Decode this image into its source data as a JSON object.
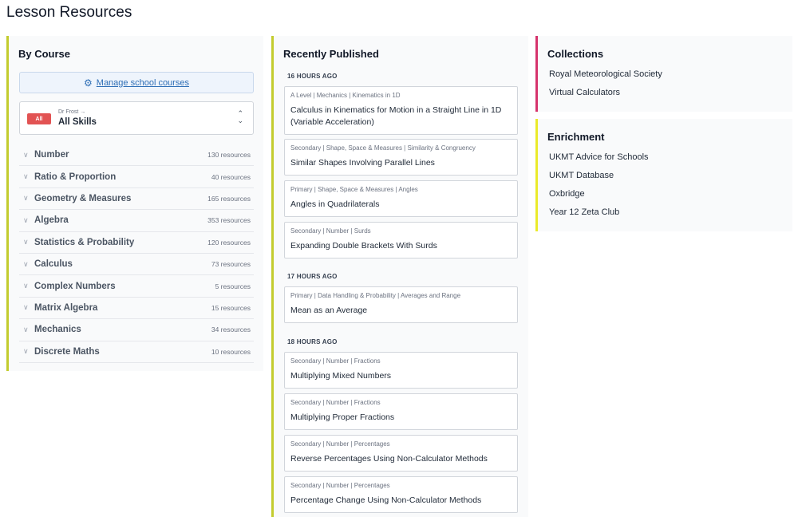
{
  "page": {
    "title": "Lesson Resources"
  },
  "by_course": {
    "title": "By Course",
    "manage_label": "Manage school courses",
    "skill_select": {
      "badge": "All",
      "author": "Dr Frost →",
      "value": "All Skills"
    },
    "courses": [
      {
        "name": "Number",
        "count": "130 resources"
      },
      {
        "name": "Ratio & Proportion",
        "count": "40 resources"
      },
      {
        "name": "Geometry & Measures",
        "count": "165 resources"
      },
      {
        "name": "Algebra",
        "count": "353 resources"
      },
      {
        "name": "Statistics & Probability",
        "count": "120 resources"
      },
      {
        "name": "Calculus",
        "count": "73 resources"
      },
      {
        "name": "Complex Numbers",
        "count": "5 resources"
      },
      {
        "name": "Matrix Algebra",
        "count": "15 resources"
      },
      {
        "name": "Mechanics",
        "count": "34 resources"
      },
      {
        "name": "Discrete Maths",
        "count": "10 resources"
      }
    ]
  },
  "recent": {
    "title": "Recently Published",
    "groups": [
      {
        "time": "16 HOURS AGO",
        "items": [
          {
            "crumb": "A Level | Mechanics | Kinematics in 1D",
            "title": "Calculus in Kinematics for Motion in a Straight Line in 1D (Variable Acceleration)"
          },
          {
            "crumb": "Secondary | Shape, Space & Measures | Similarity & Congruency",
            "title": "Similar Shapes Involving Parallel Lines"
          },
          {
            "crumb": "Primary | Shape, Space & Measures | Angles",
            "title": "Angles in Quadrilaterals"
          },
          {
            "crumb": "Secondary | Number | Surds",
            "title": "Expanding Double Brackets With Surds"
          }
        ]
      },
      {
        "time": "17 HOURS AGO",
        "items": [
          {
            "crumb": "Primary | Data Handling & Probability | Averages and Range",
            "title": "Mean as an Average"
          }
        ]
      },
      {
        "time": "18 HOURS AGO",
        "items": [
          {
            "crumb": "Secondary | Number | Fractions",
            "title": "Multiplying Mixed Numbers"
          },
          {
            "crumb": "Secondary | Number | Fractions",
            "title": "Multiplying Proper Fractions"
          },
          {
            "crumb": "Secondary | Number | Percentages",
            "title": "Reverse Percentages Using Non-Calculator Methods"
          },
          {
            "crumb": "Secondary | Number | Percentages",
            "title": "Percentage Change Using Non-Calculator Methods"
          }
        ]
      }
    ]
  },
  "collections": {
    "title": "Collections",
    "items": [
      "Royal Meteorological Society",
      "Virtual Calculators"
    ]
  },
  "enrichment": {
    "title": "Enrichment",
    "items": [
      "UKMT Advice for Schools",
      "UKMT Database",
      "Oxbridge",
      "Year 12 Zeta Club"
    ]
  },
  "icons": {
    "manage": "gear-icon",
    "course_toggle": "chevron-down-icon",
    "select": "chevron-up-down-icon"
  },
  "colors": {
    "course_bar": "#c3cc2e",
    "collections_bar": "#d6336c",
    "enrichment_bar": "#eaea2a",
    "badge": "#e25353",
    "link": "#2f6fb6"
  }
}
